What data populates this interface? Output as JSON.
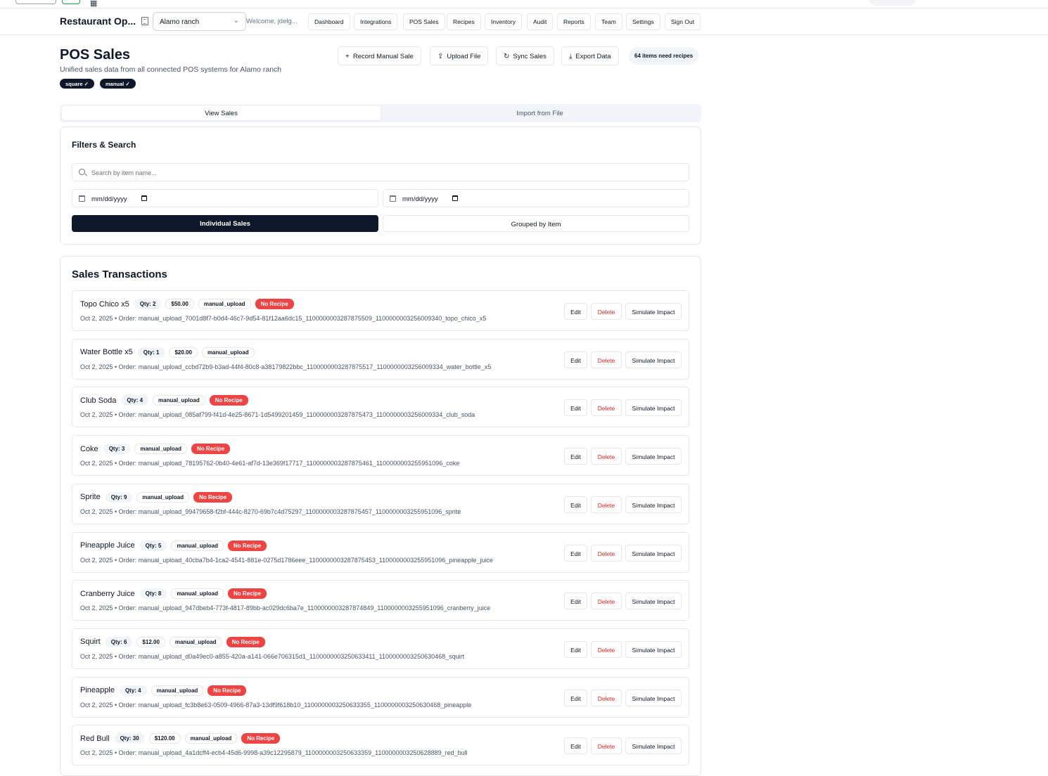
{
  "header": {
    "brand": "Restaurant Op...",
    "location": "Alamo ranch",
    "welcome": "Welcome, jdelg...",
    "nav": [
      "Dashboard",
      "Integrations",
      "POS Sales",
      "Recipes",
      "Inventory",
      "Audit",
      "Reports",
      "Team",
      "Settings",
      "Sign Out"
    ]
  },
  "page": {
    "title": "POS Sales",
    "subtitle": "Unified sales data from all connected POS systems for Alamo ranch",
    "sources": [
      "square ✓",
      "manual ✓"
    ],
    "actions": {
      "record": "Record Manual Sale",
      "upload": "Upload File",
      "sync": "Sync Sales",
      "export": "Export Data"
    },
    "needs_recipes": "64 items need recipes"
  },
  "tabs": {
    "view": "View Sales",
    "import": "Import from File"
  },
  "filters": {
    "title": "Filters & Search",
    "search_placeholder": "Search by item name...",
    "date_from": "mm/dd/yyyy",
    "date_to": "mm/dd/yyyy",
    "individual": "Individual Sales",
    "grouped": "Grouped by Item"
  },
  "transactions": {
    "title": "Sales Transactions",
    "edit_label": "Edit",
    "delete_label": "Delete",
    "simulate_label": "Simulate Impact",
    "no_recipe_label": "No Recipe",
    "rows": [
      {
        "name": "Topo Chico x5",
        "qty": "Qty: 2",
        "price": "$50.00",
        "source": "manual_upload",
        "no_recipe": true,
        "meta": "Oct 2, 2025 • Order: manual_upload_7001d8f7-b0d4-46c7-9d54-81f12aa6dc15_1100000003287875509_1100000003256009340_topo_chico_x5"
      },
      {
        "name": "Water Bottle x5",
        "qty": "Qty: 1",
        "price": "$20.00",
        "source": "manual_upload",
        "no_recipe": false,
        "meta": "Oct 2, 2025 • Order: manual_upload_ccbd72b9-b3ad-44f4-80c8-a38179822bbc_1100000003287875517_1100000003256009334_water_bottle_x5"
      },
      {
        "name": "Club Soda",
        "qty": "Qty: 4",
        "price": "",
        "source": "manual_upload",
        "no_recipe": true,
        "meta": "Oct 2, 2025 • Order: manual_upload_085af799-f41d-4e25-8671-1d5499201459_1100000003287875473_1100000003256009334_club_soda"
      },
      {
        "name": "Coke",
        "qty": "Qty: 3",
        "price": "",
        "source": "manual_upload",
        "no_recipe": true,
        "meta": "Oct 2, 2025 • Order: manual_upload_78195762-0b40-4e61-af7d-13e369f17717_1100000003287875461_1100000003255951096_coke"
      },
      {
        "name": "Sprite",
        "qty": "Qty: 9",
        "price": "",
        "source": "manual_upload",
        "no_recipe": true,
        "meta": "Oct 2, 2025 • Order: manual_upload_99479658-f2bf-444c-8270-69b7c4d75297_1100000003287875457_1100000003255951096_sprite"
      },
      {
        "name": "Pineapple Juice",
        "qty": "Qty: 5",
        "price": "",
        "source": "manual_upload",
        "no_recipe": true,
        "meta": "Oct 2, 2025 • Order: manual_upload_40cba7b4-1ca2-4541-881e-0275d1786eee_1100000003287875453_1100000003255951096_pineapple_juice"
      },
      {
        "name": "Cranberry Juice",
        "qty": "Qty: 8",
        "price": "",
        "source": "manual_upload",
        "no_recipe": true,
        "meta": "Oct 2, 2025 • Order: manual_upload_947dbeb4-773f-4817-89bb-ac029dc6ba7e_1100000003287874849_1100000003255951096_cranberry_juice"
      },
      {
        "name": "Squirt",
        "qty": "Qty: 6",
        "price": "$12.00",
        "source": "manual_upload",
        "no_recipe": true,
        "meta": "Oct 2, 2025 • Order: manual_upload_d0a49ec0-a855-420a-a141-066e706315d1_1100000003250633411_1100000003250630468_squirt"
      },
      {
        "name": "Pineapple",
        "qty": "Qty: 4",
        "price": "",
        "source": "manual_upload",
        "no_recipe": true,
        "meta": "Oct 2, 2025 • Order: manual_upload_fc3b8e63-0509-4966-87a3-13df9f618b10_1100000003250633355_1100000003250630468_pineapple"
      },
      {
        "name": "Red Bull",
        "qty": "Qty: 30",
        "price": "$120.00",
        "source": "manual_upload",
        "no_recipe": true,
        "meta": "Oct 2, 2025 • Order: manual_upload_4a1dcff4-ecb4-45d6-9998-a39c12295879_1100000003250633359_1100000003250628889_red_bull"
      }
    ]
  }
}
